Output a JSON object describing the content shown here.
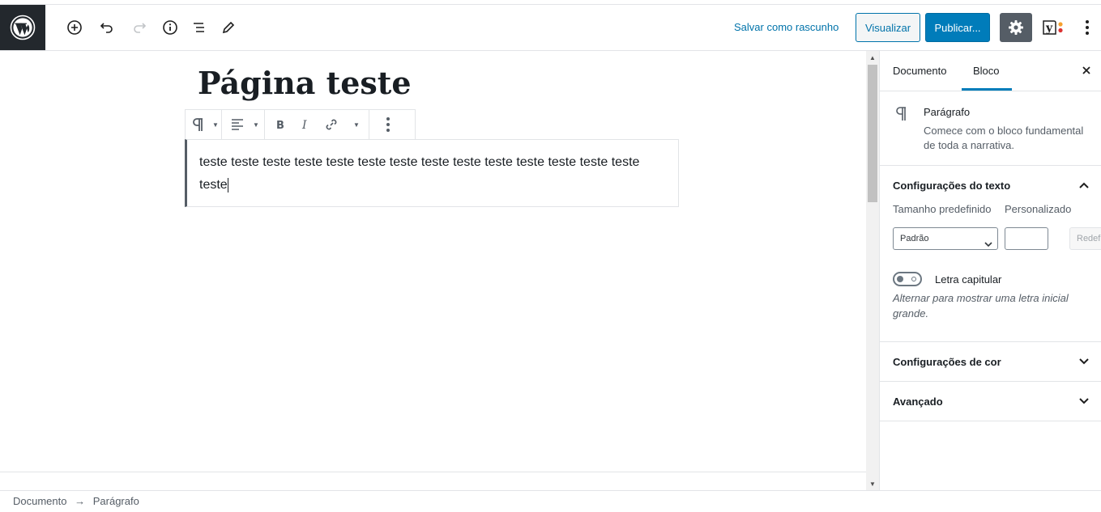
{
  "header": {
    "save_draft": "Salvar como rascunho",
    "preview": "Visualizar",
    "publish": "Publicar...",
    "yoast_text": "y"
  },
  "colors": {
    "accent": "#007cba",
    "link": "#0073aa",
    "logo_bg": "#23282d",
    "settings_bg": "#555d66"
  },
  "post": {
    "title": "Página teste",
    "paragraph": "teste teste teste teste teste teste teste teste teste teste teste teste teste teste teste"
  },
  "sidebar": {
    "tabs": [
      {
        "label": "Documento"
      },
      {
        "label": "Bloco"
      }
    ],
    "block_card": {
      "name": "Parágrafo",
      "description": "Comece com o bloco fundamental de toda a narrativa."
    },
    "text_settings": {
      "title": "Configurações do texto",
      "preset_label": "Tamanho predefinido",
      "custom_label": "Personalizado",
      "preset_value": "Padrão",
      "reset_label": "Redefinir",
      "dropcap_label": "Letra capitular",
      "dropcap_help": "Alternar para mostrar uma letra inicial grande."
    },
    "color_settings": {
      "title": "Configurações de cor"
    },
    "advanced": {
      "title": "Avançado"
    }
  },
  "footer": {
    "breadcrumb": [
      "Documento",
      "→",
      "Parágrafo"
    ]
  }
}
